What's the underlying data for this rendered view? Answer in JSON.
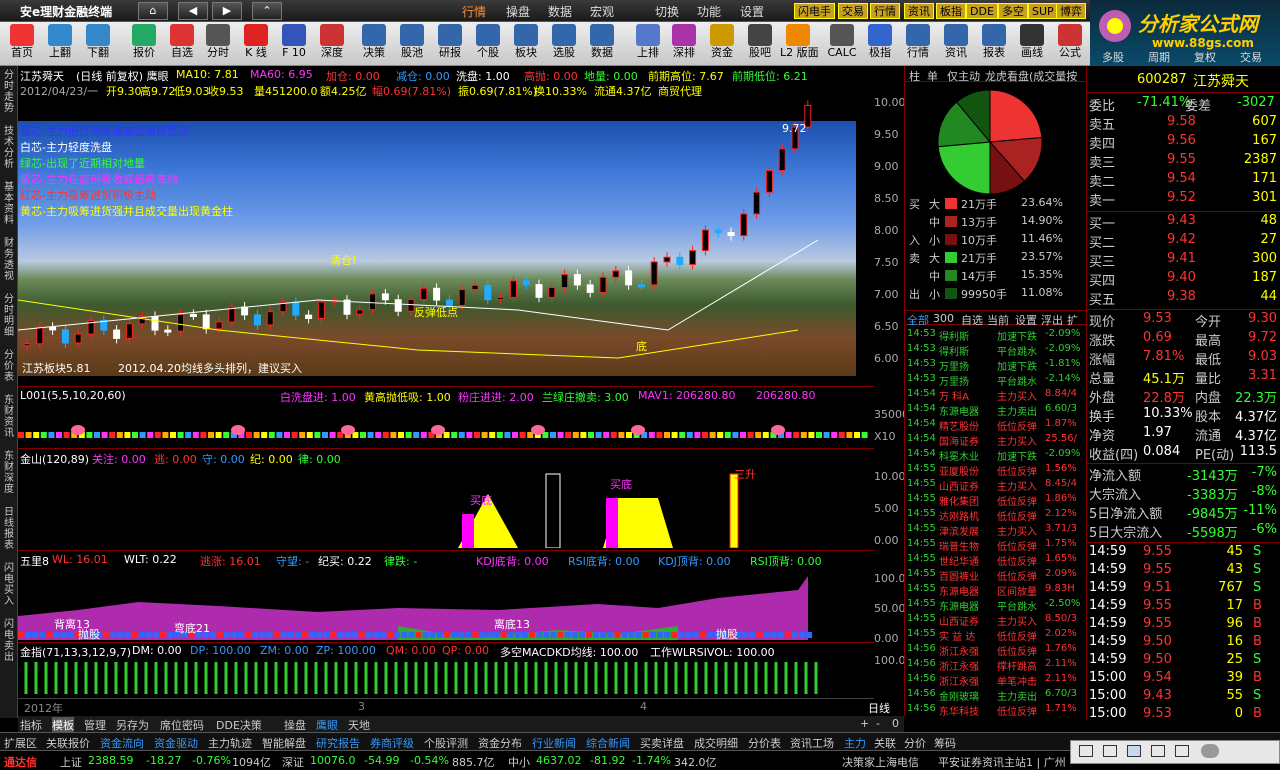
{
  "window": {
    "title": "安e理财金融终端",
    "nav": [
      "⌂",
      "◀",
      "▶",
      "⌃"
    ]
  },
  "menus": [
    {
      "label": "行情",
      "active": true
    },
    {
      "label": "操盘"
    },
    {
      "label": "数据"
    },
    {
      "label": "宏观"
    },
    {
      "label": "切换"
    },
    {
      "label": "功能"
    },
    {
      "label": "设置"
    }
  ],
  "quick_tags": [
    "闪电手",
    "交易",
    "行情",
    "资讯",
    "板指",
    "DDE",
    "多空",
    "SUP",
    "博弈"
  ],
  "brand": {
    "name": "分析家公式网",
    "url": "www.88gs.com"
  },
  "toolbar": [
    {
      "label": "首页",
      "icon": "home-icon",
      "color": "#e33"
    },
    {
      "label": "上翻",
      "icon": "up-arrow-icon",
      "color": "#38c"
    },
    {
      "label": "下翻",
      "icon": "down-arrow-icon",
      "color": "#38c"
    },
    {
      "label": "报价",
      "icon": "price-icon",
      "color": "#2a6"
    },
    {
      "label": "自选",
      "icon": "favorites-icon",
      "color": "#d33"
    },
    {
      "label": "分时",
      "icon": "intraday-icon",
      "color": "#555"
    },
    {
      "label": "K 线",
      "icon": "kline-icon",
      "color": "#d22"
    },
    {
      "label": "F 10",
      "icon": "f10-icon",
      "color": "#35b"
    },
    {
      "label": "深度",
      "icon": "depth-icon",
      "color": "#c33"
    },
    {
      "label": "决策",
      "icon": "calendar1-icon",
      "color": "#36a"
    },
    {
      "label": "股池",
      "icon": "calendar2-icon",
      "color": "#36a"
    },
    {
      "label": "研报",
      "icon": "calendar3-icon",
      "color": "#36a"
    },
    {
      "label": "个股",
      "icon": "calendar4-icon",
      "color": "#36a"
    },
    {
      "label": "板块",
      "icon": "calendar5-icon",
      "color": "#36a"
    },
    {
      "label": "选股",
      "icon": "calendar6-icon",
      "color": "#36a"
    },
    {
      "label": "数据",
      "icon": "calendar7-icon",
      "color": "#36a"
    },
    {
      "label": "上排",
      "icon": "bar-chart-icon",
      "color": "#57c"
    },
    {
      "label": "深排",
      "icon": "rank-icon",
      "color": "#a3a"
    },
    {
      "label": "资金",
      "icon": "funds-icon",
      "color": "#c90"
    },
    {
      "label": "股吧",
      "icon": "forum-icon",
      "color": "#444"
    },
    {
      "label": "L2\n版面",
      "icon": "l2-icon",
      "color": "#e80"
    },
    {
      "label": "CALC",
      "icon": "calculator-icon",
      "color": "#555"
    },
    {
      "label": "极指",
      "icon": "index-icon",
      "color": "#36c"
    },
    {
      "label": "行情",
      "icon": "quote-icon",
      "color": "#36a"
    },
    {
      "label": "资讯",
      "icon": "news-icon",
      "color": "#36a"
    },
    {
      "label": "报表",
      "icon": "report-icon",
      "color": "#36a"
    },
    {
      "label": "画线",
      "icon": "draw-icon",
      "color": "#333"
    },
    {
      "label": "公式",
      "icon": "formula-icon",
      "color": "#c33"
    }
  ],
  "right_tabs": [
    "多股",
    "周期",
    "复权",
    "交易"
  ],
  "left_tabs": [
    "分时走势",
    "技术分析",
    "基本资料",
    "财务透视",
    "分时明细",
    "分价表",
    "东财资讯",
    "东财深度",
    "日线报表",
    "闪电买入",
    "闪电卖出"
  ],
  "chart": {
    "header": {
      "name": "江苏舜天",
      "sub": "(日线 前复权) 鹰眼",
      "ma10": "MA10: 7.81",
      "ma60": "MA60: 6.95",
      "jiacang": "加仓: 0.00",
      "jiancang": "减仓: 0.00",
      "xipan": "洗盘: 1.00",
      "gaopao": "高抛: 0.00",
      "diliang": "地量: 0.00",
      "qiqi_high": "前期高位: 7.67",
      "qiqi_low": "前期低位: 6.21"
    },
    "info": {
      "date": "2012/04/23/一",
      "open": "开9.30",
      "high": "高9.72",
      "low": "低9.03",
      "close": "收9.53",
      "vol": "量451200.0",
      "amt": "额4.25亿",
      "chg": "幅0.69(7.81%)",
      "amp": "振0.69(7.81%)",
      "turn": "换10.33%",
      "float": "流通4.37亿",
      "sector": "商贸代理"
    },
    "legend": [
      {
        "text": "蓝芯-主力低位洗筹或高位出货坚决",
        "color": "#33f"
      },
      {
        "text": "白芯-主力轻度洗盘",
        "color": "#fff"
      },
      {
        "text": "绿芯-出现了近期相对地量",
        "color": "#3f3"
      },
      {
        "text": "紫芯-主力在底部吸收或低吸高抛",
        "color": "#f3f"
      },
      {
        "text": "红芯-主力吸筹进货积极主动",
        "color": "#f33"
      },
      {
        "text": "黄芯-主力吸筹进货强并且成交量出现黄金柱",
        "color": "#ff0"
      }
    ],
    "annotations": {
      "high": "9.72",
      "qingcang": "清仓!",
      "fantan": "反弹低点",
      "bottom": "底",
      "note": "2012.04.20均线多头排列，建议买入",
      "low": "江苏板块5.81"
    },
    "price_axis": [
      "10.00",
      "9.50",
      "9.00",
      "8.50",
      "8.00",
      "7.50",
      "7.00",
      "6.50",
      "6.00"
    ],
    "p2": {
      "name": "L001(5,5,10,20,60)",
      "baixi": "白洗盘进: 1.00",
      "huanggao": "黄高抛低吸: 1.00",
      "fenjin": "粉庄进进: 2.00",
      "lanlv": "兰绿庄撤卖: 3.00",
      "mav1": "MAV1: 206280.80",
      "last": "206280.80",
      "axis": "35000",
      "x10": "X10"
    },
    "p3": {
      "name": "金山(120,89)",
      "guanzhu": "关注: 0.00",
      "dao": "逃: 0.00",
      "shou": "守: 0.00",
      "ji": "纪: 0.00",
      "lv": "律: 0.00",
      "maidi1": "买底",
      "maidi2": "买底",
      "sansheng": "三升",
      "axis": [
        "10.00",
        "5.00",
        "0.00"
      ]
    },
    "p4": {
      "name": "五里8",
      "wl": "WL: 16.01",
      "wlt": "WLT: 0.22",
      "tao": "逃涨: 16.01",
      "shouwang": "守望: -",
      "jimai": "纪买: 0.22",
      "lvdie": "律跌: -",
      "kdjdi": "KDJ底背: 0.00",
      "rsidi": "RSI底背: 0.00",
      "kdjding": "KDJ顶背: 0.00",
      "rsiding": "RSI顶背: 0.00",
      "tags": [
        "背离13",
        "弯底21",
        "离底13",
        "抛股",
        "抛股"
      ],
      "axis": [
        "100.00",
        "50.00",
        "0.00"
      ]
    },
    "p5": {
      "name": "金指(71,13,3,12,9,7)",
      "dm": "DM: 0.00",
      "dp": "DP: 100.00",
      "zm": "ZM: 0.00",
      "zp": "ZP: 100.00",
      "qm": "QM: 0.00",
      "qp": "QP: 0.00",
      "duokong": "多空MACDKD均线: 100.00",
      "work": "工作WLRSIVOL: 100.00",
      "axis": "100.0"
    },
    "xaxis": {
      "year": "2012年",
      "m3": "3",
      "m4": "4",
      "period": "日线"
    }
  },
  "pie": {
    "tabs": [
      "柱",
      "单",
      "仅主动",
      "龙虎看盘(成交量按"
    ],
    "flows": [
      {
        "side": "买",
        "size": "大",
        "amount": "21万手",
        "pct": "23.64%",
        "color": "#e33"
      },
      {
        "side": "",
        "size": "中",
        "amount": "13万手",
        "pct": "14.90%",
        "color": "#a22"
      },
      {
        "side": "入",
        "size": "小",
        "amount": "10万手",
        "pct": "11.46%",
        "color": "#711"
      },
      {
        "side": "卖",
        "size": "大",
        "amount": "21万手",
        "pct": "23.57%",
        "color": "#3c3"
      },
      {
        "side": "",
        "size": "中",
        "amount": "14万手",
        "pct": "15.35%",
        "color": "#282"
      },
      {
        "side": "出",
        "size": "小",
        "amount": "99950手",
        "pct": "11.08%",
        "color": "#151"
      }
    ]
  },
  "tape_tabs": [
    "全部",
    "300",
    "自选",
    "当前",
    "设置",
    "浮出",
    "扩"
  ],
  "tape": [
    {
      "time": "14:53",
      "name": "得利斯",
      "sig": "加速下跌",
      "val": "-2.09%",
      "c": "g"
    },
    {
      "time": "14:53",
      "name": "得利斯",
      "sig": "平台跳水",
      "val": "-2.09%",
      "c": "g"
    },
    {
      "time": "14:53",
      "name": "万里扬",
      "sig": "加速下跌",
      "val": "-1.81%",
      "c": "g"
    },
    {
      "time": "14:53",
      "name": "万里扬",
      "sig": "平台跳水",
      "val": "-2.14%",
      "c": "g"
    },
    {
      "time": "14:54",
      "name": "万 科A",
      "sig": "主力买入",
      "val": "8.84/4",
      "c": "r"
    },
    {
      "time": "14:54",
      "name": "东源电器",
      "sig": "主力卖出",
      "val": "6.60/3",
      "c": "g"
    },
    {
      "time": "14:54",
      "name": "精艺股份",
      "sig": "低位反弹",
      "val": "1.87%",
      "c": "r"
    },
    {
      "time": "14:54",
      "name": "国海证券",
      "sig": "主力买入",
      "val": "25.56/",
      "c": "r"
    },
    {
      "time": "14:54",
      "name": "科冕木业",
      "sig": "加速下跌",
      "val": "-2.09%",
      "c": "g"
    },
    {
      "time": "14:55",
      "name": "亚厦股份",
      "sig": "低位反弹",
      "val": "1.56%",
      "c": "r"
    },
    {
      "time": "14:55",
      "name": "山西证券",
      "sig": "主力买入",
      "val": "8.45/4",
      "c": "r"
    },
    {
      "time": "14:55",
      "name": "雅化集团",
      "sig": "低位反弹",
      "val": "1.86%",
      "c": "r"
    },
    {
      "time": "14:55",
      "name": "达刚路机",
      "sig": "低位反弹",
      "val": "2.12%",
      "c": "r"
    },
    {
      "time": "14:55",
      "name": "津滨发展",
      "sig": "主力买入",
      "val": "3.71/3",
      "c": "r"
    },
    {
      "time": "14:55",
      "name": "瑞普生物",
      "sig": "低位反弹",
      "val": "1.75%",
      "c": "r"
    },
    {
      "time": "14:55",
      "name": "世纪华通",
      "sig": "低位反弹",
      "val": "1.65%",
      "c": "r"
    },
    {
      "time": "14:55",
      "name": "百圆裤业",
      "sig": "低位反弹",
      "val": "2.09%",
      "c": "r"
    },
    {
      "time": "14:55",
      "name": "东源电器",
      "sig": "区间放量",
      "val": "9.83H",
      "c": "r"
    },
    {
      "time": "14:55",
      "name": "东源电器",
      "sig": "平台跳水",
      "val": "-2.50%",
      "c": "g"
    },
    {
      "time": "14:55",
      "name": "山西证券",
      "sig": "主力买入",
      "val": "8.50/3",
      "c": "r"
    },
    {
      "time": "14:55",
      "name": "实 益 达",
      "sig": "低位反弹",
      "val": "2.02%",
      "c": "r"
    },
    {
      "time": "14:56",
      "name": "浙江永强",
      "sig": "低位反弹",
      "val": "1.76%",
      "c": "r"
    },
    {
      "time": "14:56",
      "name": "浙江永强",
      "sig": "撑杆跳高",
      "val": "2.11%",
      "c": "r"
    },
    {
      "time": "14:56",
      "name": "浙江永强",
      "sig": "单笔冲击",
      "val": "2.11%",
      "c": "r"
    },
    {
      "time": "14:56",
      "name": "金刚玻璃",
      "sig": "主力卖出",
      "val": "6.70/3",
      "c": "g"
    },
    {
      "time": "14:56",
      "name": "东华科技",
      "sig": "低位反弹",
      "val": "1.71%",
      "c": "r"
    }
  ],
  "quote": {
    "code": "600287",
    "name": "江苏舜天",
    "weibi": {
      "l1": "委比",
      "v1": "-71.41%",
      "l2": "委差",
      "v2": "-3027"
    },
    "asks": [
      {
        "l": "卖五",
        "p": "9.58",
        "v": "607"
      },
      {
        "l": "卖四",
        "p": "9.56",
        "v": "167"
      },
      {
        "l": "卖三",
        "p": "9.55",
        "v": "2387"
      },
      {
        "l": "卖二",
        "p": "9.54",
        "v": "171"
      },
      {
        "l": "卖一",
        "p": "9.52",
        "v": "301"
      }
    ],
    "bids": [
      {
        "l": "买一",
        "p": "9.43",
        "v": "48"
      },
      {
        "l": "买二",
        "p": "9.42",
        "v": "27"
      },
      {
        "l": "买三",
        "p": "9.41",
        "v": "300"
      },
      {
        "l": "买四",
        "p": "9.40",
        "v": "187"
      },
      {
        "l": "买五",
        "p": "9.38",
        "v": "44"
      }
    ],
    "stats": [
      {
        "l1": "现价",
        "v1": "9.53",
        "c1": "r",
        "l2": "今开",
        "v2": "9.30",
        "c2": "r"
      },
      {
        "l1": "涨跌",
        "v1": "0.69",
        "c1": "r",
        "l2": "最高",
        "v2": "9.72",
        "c2": "r"
      },
      {
        "l1": "涨幅",
        "v1": "7.81%",
        "c1": "r",
        "l2": "最低",
        "v2": "9.03",
        "c2": "r"
      },
      {
        "l1": "总量",
        "v1": "45.1万",
        "c1": "y",
        "l2": "量比",
        "v2": "3.31",
        "c2": "r"
      },
      {
        "l1": "外盘",
        "v1": "22.8万",
        "c1": "r",
        "l2": "内盘",
        "v2": "22.3万",
        "c2": "g"
      },
      {
        "l1": "换手",
        "v1": "10.33%",
        "c1": "w",
        "l2": "股本",
        "v2": "4.37亿",
        "c2": "w"
      },
      {
        "l1": "净资",
        "v1": "1.97",
        "c1": "w",
        "l2": "流通",
        "v2": "4.37亿",
        "c2": "w"
      },
      {
        "l1": "收益(四)",
        "v1": "0.084",
        "c1": "w",
        "l2": "PE(动)",
        "v2": "113.5",
        "c2": "w"
      }
    ],
    "flows": [
      {
        "l": "净流入额",
        "v": "-3143万",
        "p": "-7%"
      },
      {
        "l": "大宗流入",
        "v": "-3383万",
        "p": "-8%"
      },
      {
        "l": "5日净流入额",
        "v": "-9845万",
        "p": "-11%"
      },
      {
        "l": "5日大宗流入",
        "v": "-5598万",
        "p": "-6%"
      }
    ],
    "ticks": [
      {
        "t": "14:59",
        "p": "9.55",
        "v": "45",
        "s": "S"
      },
      {
        "t": "14:59",
        "p": "9.55",
        "v": "43",
        "s": "S"
      },
      {
        "t": "14:59",
        "p": "9.51",
        "v": "767",
        "s": "S"
      },
      {
        "t": "14:59",
        "p": "9.55",
        "v": "17",
        "s": "B"
      },
      {
        "t": "14:59",
        "p": "9.55",
        "v": "96",
        "s": "B"
      },
      {
        "t": "14:59",
        "p": "9.50",
        "v": "16",
        "s": "B"
      },
      {
        "t": "14:59",
        "p": "9.50",
        "v": "25",
        "s": "S"
      },
      {
        "t": "15:00",
        "p": "9.54",
        "v": "39",
        "s": "B"
      },
      {
        "t": "15:00",
        "p": "9.43",
        "v": "55",
        "s": "S"
      },
      {
        "t": "15:00",
        "p": "9.53",
        "v": "0",
        "s": "B"
      }
    ]
  },
  "bottom_tabs": [
    "指标",
    "模板",
    "管理",
    "另存为",
    "席位密码",
    "DDE决策",
    "操盘",
    "鹰眼",
    "天地"
  ],
  "bottom_tabs_right": [
    "+",
    "-",
    "0"
  ],
  "func_tabs": [
    "扩展区",
    "关联报价",
    "资金流向",
    "资金驱动",
    "主力轨迹",
    "智能解盘",
    "研究报告",
    "券商评级",
    "个股评测",
    "资金分布",
    "行业新闻",
    "综合新闻",
    "买卖详盘",
    "成交明细",
    "分价表",
    "资讯工场",
    "主力",
    "关联",
    "分价",
    "筹码"
  ],
  "status": {
    "label": "通达信",
    "sh": "上证",
    "sh_v": "2388.59",
    "sh_c": "-18.27",
    "sh_p": "-0.76%",
    "sh_a": "1094亿",
    "sz": "深证",
    "sz_v": "10076.0",
    "sz_c": "-54.99",
    "sz_p": "-0.54%",
    "sz_a": "885.7亿",
    "zx": "中小",
    "zx_v": "4637.02",
    "zx_c": "-81.92",
    "zx_p": "-1.74%",
    "zx_a": "342.0亿",
    "server": "决策家上海电信",
    "ticker": "平安证券资讯主站1 | 广州"
  }
}
